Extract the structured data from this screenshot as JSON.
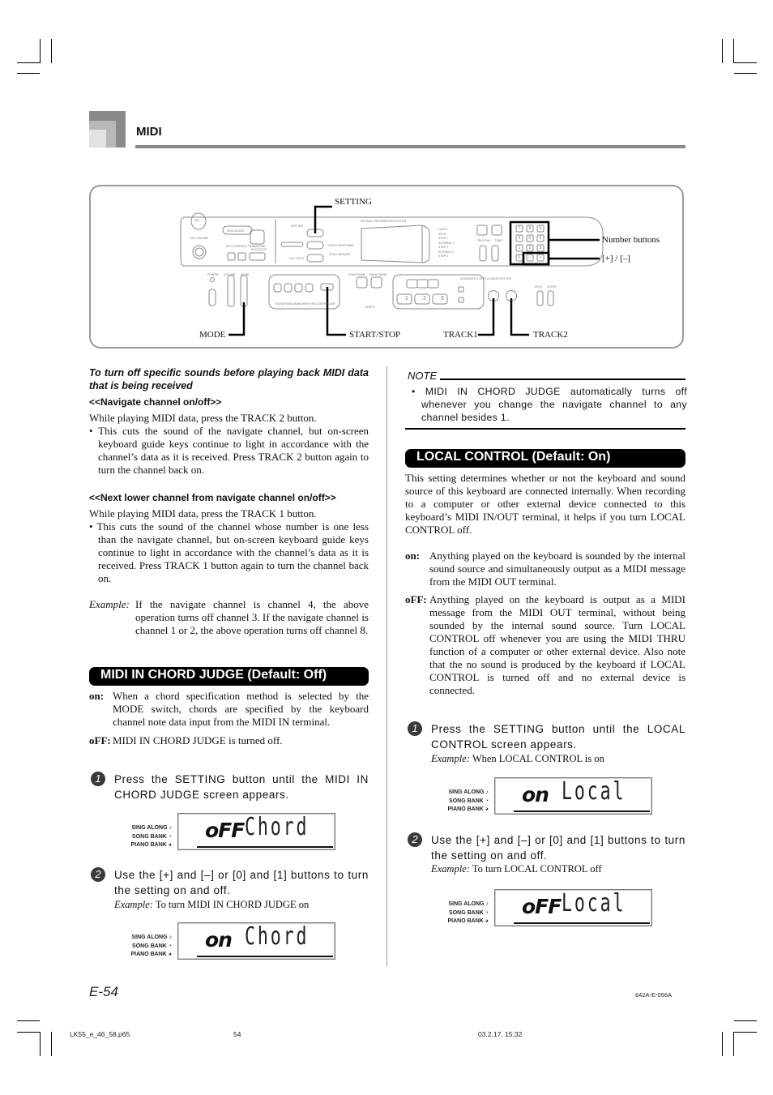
{
  "header": {
    "section_title": "MIDI"
  },
  "diagram": {
    "callouts": {
      "setting": "SETTING",
      "number_buttons": "Number buttons",
      "plus_minus": "[+] / [–]",
      "mode": "MODE",
      "start_stop": "START/STOP",
      "track1": "TRACK1",
      "track2": "TRACK2"
    },
    "panel_labels": {
      "mic": "MIC",
      "mic_volume": "MIC VOLUME",
      "sing_along": "SING ALONG",
      "key_control": "KEY CONTROL/ TRANSPOSE",
      "play_stop": "PLAY/STOP",
      "setting_small": "SETTING",
      "key_light": "KEY LIGHT",
      "touch_response": "TOUCH RESPONSE",
      "song_memory": "SONG MEMORY",
      "info_system": "MUSICAL INFORMATION SYSTEM",
      "rhythm": "RHYTHM",
      "tone": "TONE",
      "power": "POWER",
      "volume": "VOLUME",
      "mode_small": "MODE",
      "song_bank": "SONG BANK",
      "piano_bank": "PIANO BANK",
      "tempo": "TEMPO",
      "controller": "SONG/PIANO BANK/RHYTHM CONTROLLER",
      "lesson_system": "ADVANCED 3-STEP LESSON SYSTEM",
      "split": "SPLIT",
      "layer": "LAYER",
      "right_labels": [
        "LAYER",
        "SPLIT",
        "STEP 1",
        "SCORING 1",
        "STEP 2",
        "SCORING 2",
        "STEP 3"
      ],
      "number_keys": [
        "7",
        "8",
        "9",
        "4",
        "5",
        "6",
        "1",
        "2",
        "3",
        "0",
        "–",
        "+"
      ],
      "step_keys": [
        "1",
        "2",
        "3"
      ]
    }
  },
  "left_column": {
    "heading": "To turn off specific sounds before playing back MIDI data that is being received",
    "navigate_heading": "<<Navigate channel on/off>>",
    "navigate_intro": "While playing MIDI data, press the TRACK 2 button.",
    "navigate_bullet": "• This cuts the sound of the navigate channel, but on-screen keyboard guide keys continue to light in accordance with the channel’s data as it is received. Press TRACK 2 button again to turn the channel back on.",
    "lower_heading": "<<Next lower channel from navigate channel on/off>>",
    "lower_intro": "While playing MIDI data, press the TRACK 1 button.",
    "lower_bullet": "• This cuts the sound of the channel whose number is one less than the navigate channel, but on-screen keyboard guide keys continue to light in accordance with the channel’s data as it is received. Press TRACK 1 button again to turn the channel back on.",
    "example_label": "Example:",
    "example_text": "If the navigate channel is channel 4, the above operation turns off channel 3. If the navigate channel is channel 1 or 2, the above operation turns off channel 8.",
    "chord_judge": {
      "banner": "MIDI IN CHORD JUDGE (Default: Off)",
      "on_term": "on:",
      "on_text": "When a chord specification method is selected by the MODE switch, chords are specified by the keyboard channel note data input from the MIDI IN terminal.",
      "off_term": "oFF:",
      "off_text": "MIDI IN CHORD JUDGE is turned off.",
      "step1_num": "1",
      "step1_text": "Press the SETTING button until the MIDI IN CHORD JUDGE screen appears.",
      "lcd1": {
        "state": "oFF",
        "word": "Chord"
      },
      "step2_num": "2",
      "step2_text": "Use the [+] and [–] or [0] and [1] buttons to turn the setting on and off.",
      "step2_example_label": "Example:",
      "step2_example": "To turn MIDI IN CHORD JUDGE on",
      "lcd2": {
        "state": "on",
        "word": "Chord"
      }
    }
  },
  "lcd_side_labels": [
    "SING ALONG",
    "SONG BANK",
    "PIANO BANK"
  ],
  "right_column": {
    "note_title": "NOTE",
    "note_text": "• MIDI IN CHORD JUDGE automatically turns off whenever you change the navigate channel to any channel besides 1.",
    "local_control": {
      "banner": "LOCAL CONTROL (Default: On)",
      "intro": "This setting determines whether or not the keyboard and sound source of this keyboard are connected internally. When recording to a computer or other external device connected to this keyboard’s MIDI IN/OUT terminal, it helps if you turn LOCAL CONTROL off.",
      "on_term": "on:",
      "on_text": "Anything played on the keyboard is sounded by the internal sound source and simultaneously output as a MIDI message from the MIDI OUT terminal.",
      "off_term": "oFF:",
      "off_text": "Anything played on the keyboard is output as a MIDI message from the MIDI OUT terminal, without being sounded by the internal sound source. Turn LOCAL CONTROL off whenever you are using the MIDI THRU function of a computer or other external device. Also note that the no sound is produced by the keyboard if LOCAL CONTROL is turned off and no external device is connected.",
      "step1_num": "1",
      "step1_text": "Press the SETTING button until the LOCAL CONTROL screen appears.",
      "step1_example_label": "Example:",
      "step1_example": "When LOCAL CONTROL is on",
      "lcd1": {
        "state": "on",
        "word": "Local"
      },
      "step2_num": "2",
      "step2_text": "Use the [+] and [–] or [0] and [1] buttons to turn the setting on and off.",
      "step2_example_label": "Example:",
      "step2_example": "To turn LOCAL CONTROL off",
      "lcd2": {
        "state": "oFF",
        "word": "Local"
      }
    }
  },
  "footer": {
    "page_number": "E-54",
    "doc_code": "642A-E-056A",
    "file_name": "LK55_e_46_58.p65",
    "print_page": "54",
    "print_date": "03.2.17, 15:32"
  }
}
